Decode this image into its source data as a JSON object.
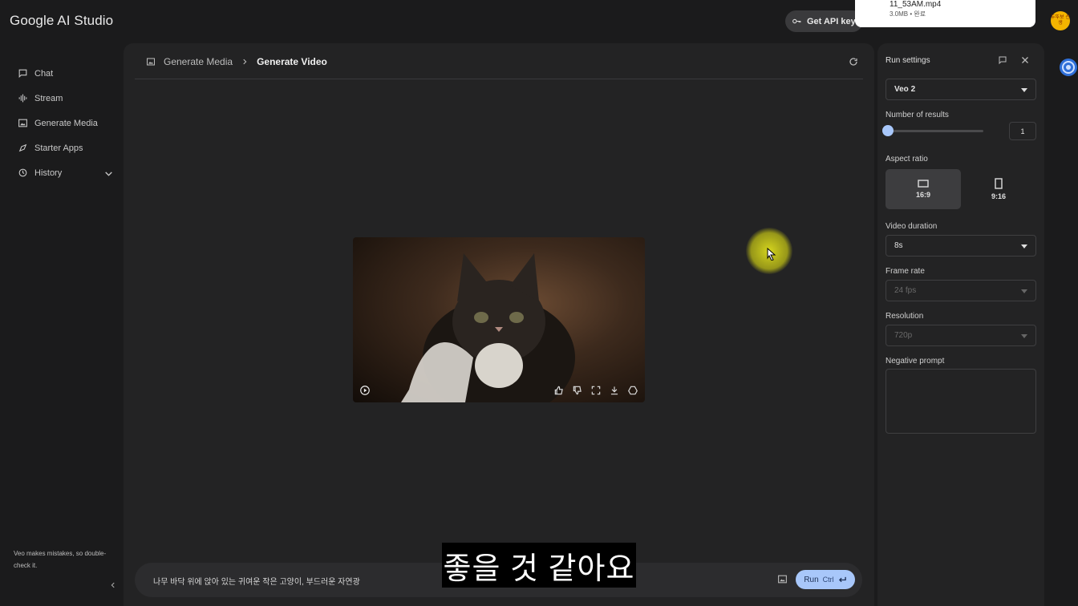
{
  "app": {
    "title": "Google AI Studio"
  },
  "header": {
    "api_key_label": "Get API key"
  },
  "download": {
    "file_name": "11_53AM.mp4",
    "meta": "3.0MB • 완료"
  },
  "avatar": {
    "text": "두뚜보 선생"
  },
  "sidebar": {
    "items": [
      {
        "label": "Chat",
        "icon": "chat-icon"
      },
      {
        "label": "Stream",
        "icon": "stream-icon"
      },
      {
        "label": "Generate Media",
        "icon": "media-icon"
      },
      {
        "label": "Starter Apps",
        "icon": "apps-icon"
      },
      {
        "label": "History",
        "icon": "history-icon"
      }
    ],
    "disclaimer": "Veo makes mistakes, so double-check it."
  },
  "breadcrumb": {
    "parent": "Generate Media",
    "current": "Generate Video"
  },
  "prompt": {
    "text": "나무 바닥 위에 앉아 있는 귀여운 작은 고양이, 부드러운 자연광",
    "run_label": "Run",
    "run_shortcut": "Ctrl"
  },
  "subtitle": {
    "text": "좋을 것 같아요"
  },
  "run_settings": {
    "title": "Run settings",
    "model": "Veo 2",
    "number_of_results_label": "Number of results",
    "number_of_results_value": "1",
    "aspect_ratio_label": "Aspect ratio",
    "aspect_ratios": [
      {
        "label": "16:9",
        "selected": true
      },
      {
        "label": "9:16",
        "selected": false
      }
    ],
    "video_duration_label": "Video duration",
    "video_duration": "8s",
    "frame_rate_label": "Frame rate",
    "frame_rate": "24 fps",
    "resolution_label": "Resolution",
    "resolution": "720p",
    "negative_prompt_label": "Negative prompt"
  },
  "colors": {
    "accent": "#a8c7fa",
    "background": "#1b1b1c",
    "surface": "#232324"
  }
}
